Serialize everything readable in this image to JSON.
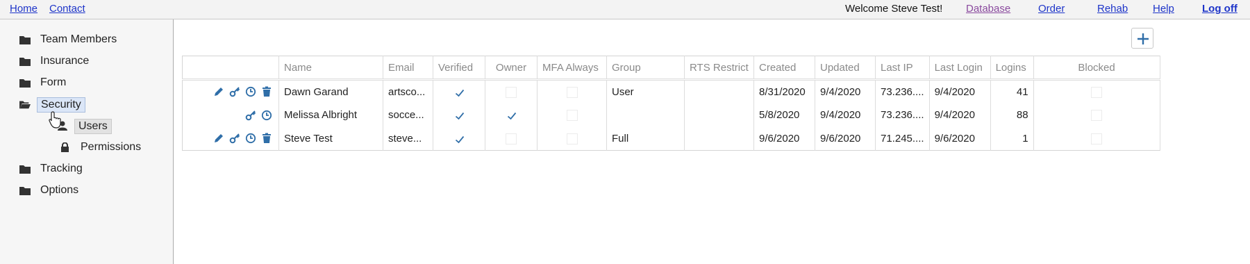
{
  "topbar": {
    "home": "Home",
    "contact": "Contact",
    "welcome": "Welcome Steve Test!",
    "database": "Database",
    "order": "Order",
    "rehab": "Rehab",
    "help": "Help",
    "logoff": "Log off"
  },
  "sidebar": {
    "items": [
      {
        "label": "Team Members",
        "icon": "folder-icon"
      },
      {
        "label": "Insurance",
        "icon": "folder-icon"
      },
      {
        "label": "Form",
        "icon": "folder-icon"
      },
      {
        "label": "Security",
        "icon": "folder-open-icon",
        "expanded": true
      },
      {
        "label": "Users",
        "icon": "user-icon",
        "hovered": true
      },
      {
        "label": "Permissions",
        "icon": "lock-icon"
      },
      {
        "label": "Tracking",
        "icon": "folder-icon"
      },
      {
        "label": "Options",
        "icon": "folder-icon"
      }
    ]
  },
  "main": {
    "add_button_icon": "plus-icon"
  },
  "table": {
    "columns": [
      "",
      "Name",
      "Email",
      "Verified",
      "Owner",
      "MFA Always",
      "Group",
      "RTS Restrict",
      "Created",
      "Updated",
      "Last IP",
      "Last Login",
      "Logins",
      "Blocked"
    ],
    "rows": [
      {
        "actions": [
          "edit-icon",
          "key-icon",
          "history-icon",
          "delete-icon"
        ],
        "name": "Dawn Garand",
        "email": "artsco...",
        "verified": true,
        "owner": false,
        "mfa_always": false,
        "group": "User",
        "rts_restrict": "",
        "created": "8/31/2020",
        "updated": "9/4/2020",
        "last_ip": "73.236....",
        "last_login": "9/4/2020",
        "logins": "41",
        "blocked": false
      },
      {
        "actions": [
          "key-icon",
          "history-icon"
        ],
        "name": "Melissa Albright",
        "email": "socce...",
        "verified": true,
        "owner": true,
        "mfa_always": false,
        "group": "",
        "rts_restrict": "",
        "created": "5/8/2020",
        "updated": "9/4/2020",
        "last_ip": "73.236....",
        "last_login": "9/4/2020",
        "logins": "88",
        "blocked": false
      },
      {
        "actions": [
          "edit-icon",
          "key-icon",
          "history-icon",
          "delete-icon"
        ],
        "name": "Steve Test",
        "email": "steve...",
        "verified": true,
        "owner": false,
        "mfa_always": false,
        "group": "Full",
        "rts_restrict": "",
        "created": "9/6/2020",
        "updated": "9/6/2020",
        "last_ip": "71.245....",
        "last_login": "9/6/2020",
        "logins": "1",
        "blocked": false
      }
    ]
  },
  "colors": {
    "link": "#1d34c9",
    "visited_link": "#8a4a9e",
    "icon_blue": "#2f6ea8",
    "selected_bg": "#dbe6f7"
  }
}
